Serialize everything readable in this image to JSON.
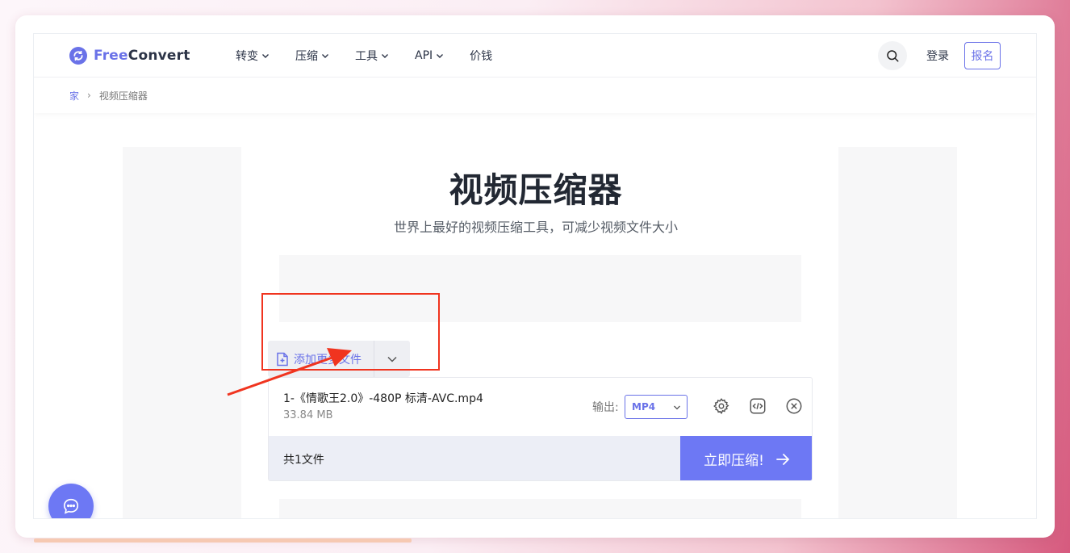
{
  "brand": {
    "name_part1": "Free",
    "name_part2": "Convert",
    "accent_color": "#6a72e8"
  },
  "nav": {
    "items": [
      {
        "label": "转变"
      },
      {
        "label": "压缩"
      },
      {
        "label": "工具"
      },
      {
        "label": "API"
      },
      {
        "label": "价钱"
      }
    ],
    "login_label": "登录",
    "signup_label": "报名"
  },
  "breadcrumb": {
    "home": "家",
    "current": "视频压缩器"
  },
  "hero": {
    "title": "视频压缩器",
    "subtitle": "世界上最好的视频压缩工具，可减少视频文件大小"
  },
  "uploader": {
    "add_more_label": "添加更多文件",
    "file": {
      "name": "1-《情歌王2.0》-480P 标清-AVC.mp4",
      "size": "33.84 MB",
      "output_label": "输出:",
      "output_format": "MP4"
    },
    "file_count_label": "共1文件",
    "compress_label": "立即压缩!",
    "compress_color": "#6d78f4"
  },
  "annotation": {
    "highlight_color": "#f0341f"
  }
}
